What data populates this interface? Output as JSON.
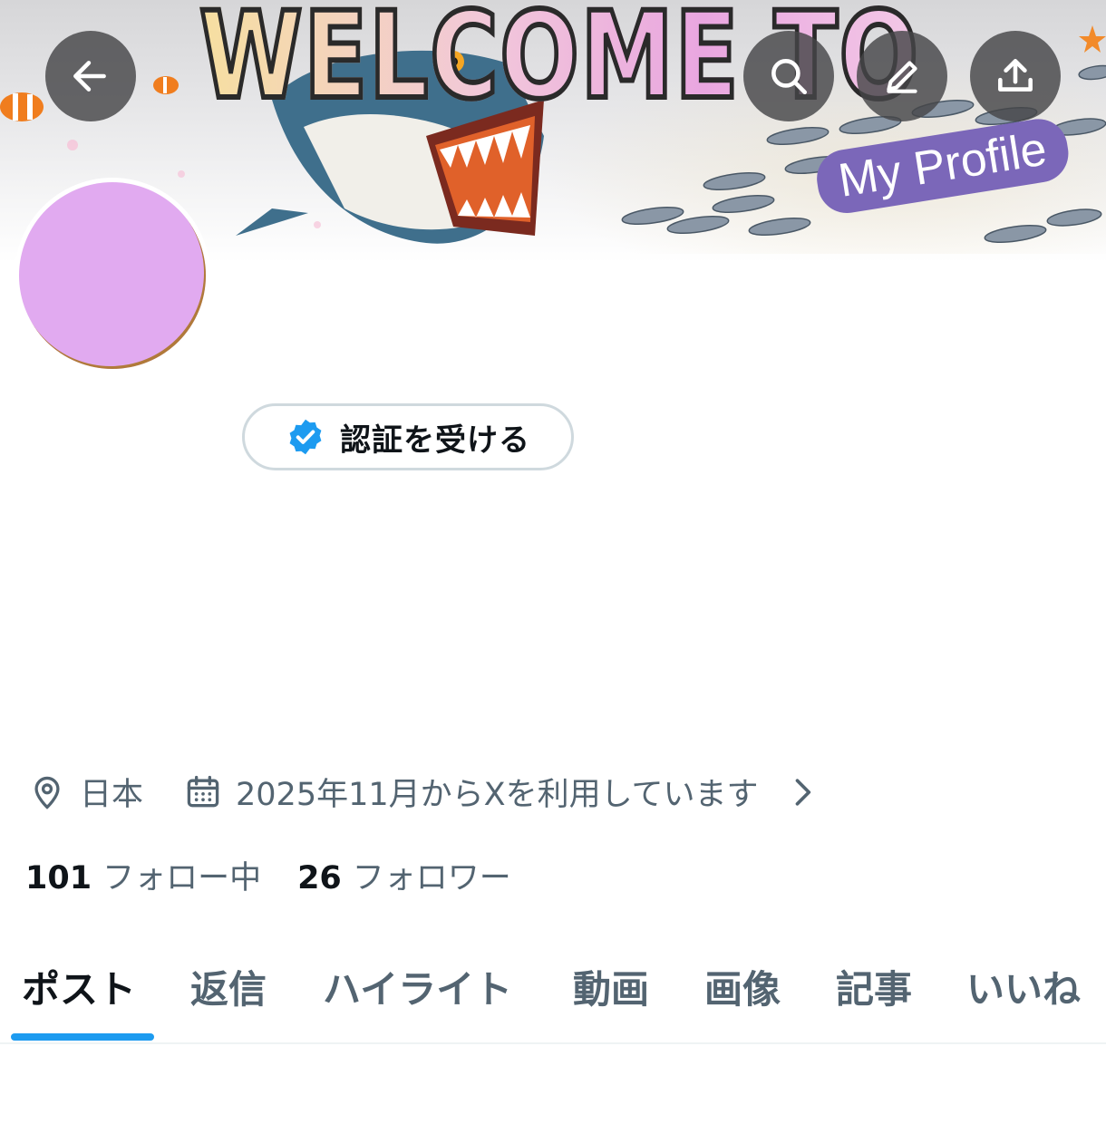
{
  "banner": {
    "headline": "WELCOME TO",
    "badge": "My Profile"
  },
  "header": {
    "back_icon": "arrow-left-icon",
    "search_icon": "search-icon",
    "edit_icon": "pencil-icon",
    "share_icon": "share-upload-icon"
  },
  "profile": {
    "avatar_color": "#e1aaf0",
    "verify_button_label": "認証を受ける"
  },
  "meta": {
    "location": "日本",
    "joined": "2025年11月からXを利用しています"
  },
  "stats": {
    "following_count": "101",
    "following_label": "フォロー中",
    "followers_count": "26",
    "followers_label": "フォロワー"
  },
  "tabs": [
    {
      "label": "ポスト",
      "active": true
    },
    {
      "label": "返信",
      "active": false
    },
    {
      "label": "ハイライト",
      "active": false
    },
    {
      "label": "動画",
      "active": false
    },
    {
      "label": "画像",
      "active": false
    },
    {
      "label": "記事",
      "active": false
    },
    {
      "label": "いいね",
      "active": false
    }
  ],
  "colors": {
    "accent": "#1d9bf0",
    "secondary_text": "#536471",
    "badge_purple": "#7b67b9"
  }
}
